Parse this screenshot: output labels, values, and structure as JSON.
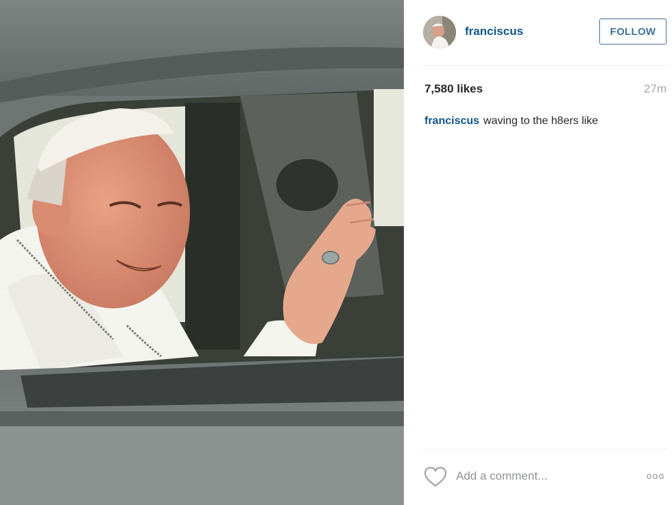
{
  "post": {
    "username": "franciscus",
    "follow_label": "FOLLOW",
    "likes": "7,580 likes",
    "time_ago": "27m",
    "caption_user": "franciscus",
    "caption_text": "waving to the h8ers like"
  },
  "comment": {
    "placeholder": "Add a comment...",
    "more_label": "ooo"
  },
  "photo": {
    "alt": "Man in white cap waving from a car window"
  },
  "colors": {
    "link": "#125688",
    "follow_border": "#3f729b",
    "muted": "#a5a7aa",
    "text": "#262626"
  },
  "icons": [
    "heart-icon",
    "more-options-icon"
  ]
}
